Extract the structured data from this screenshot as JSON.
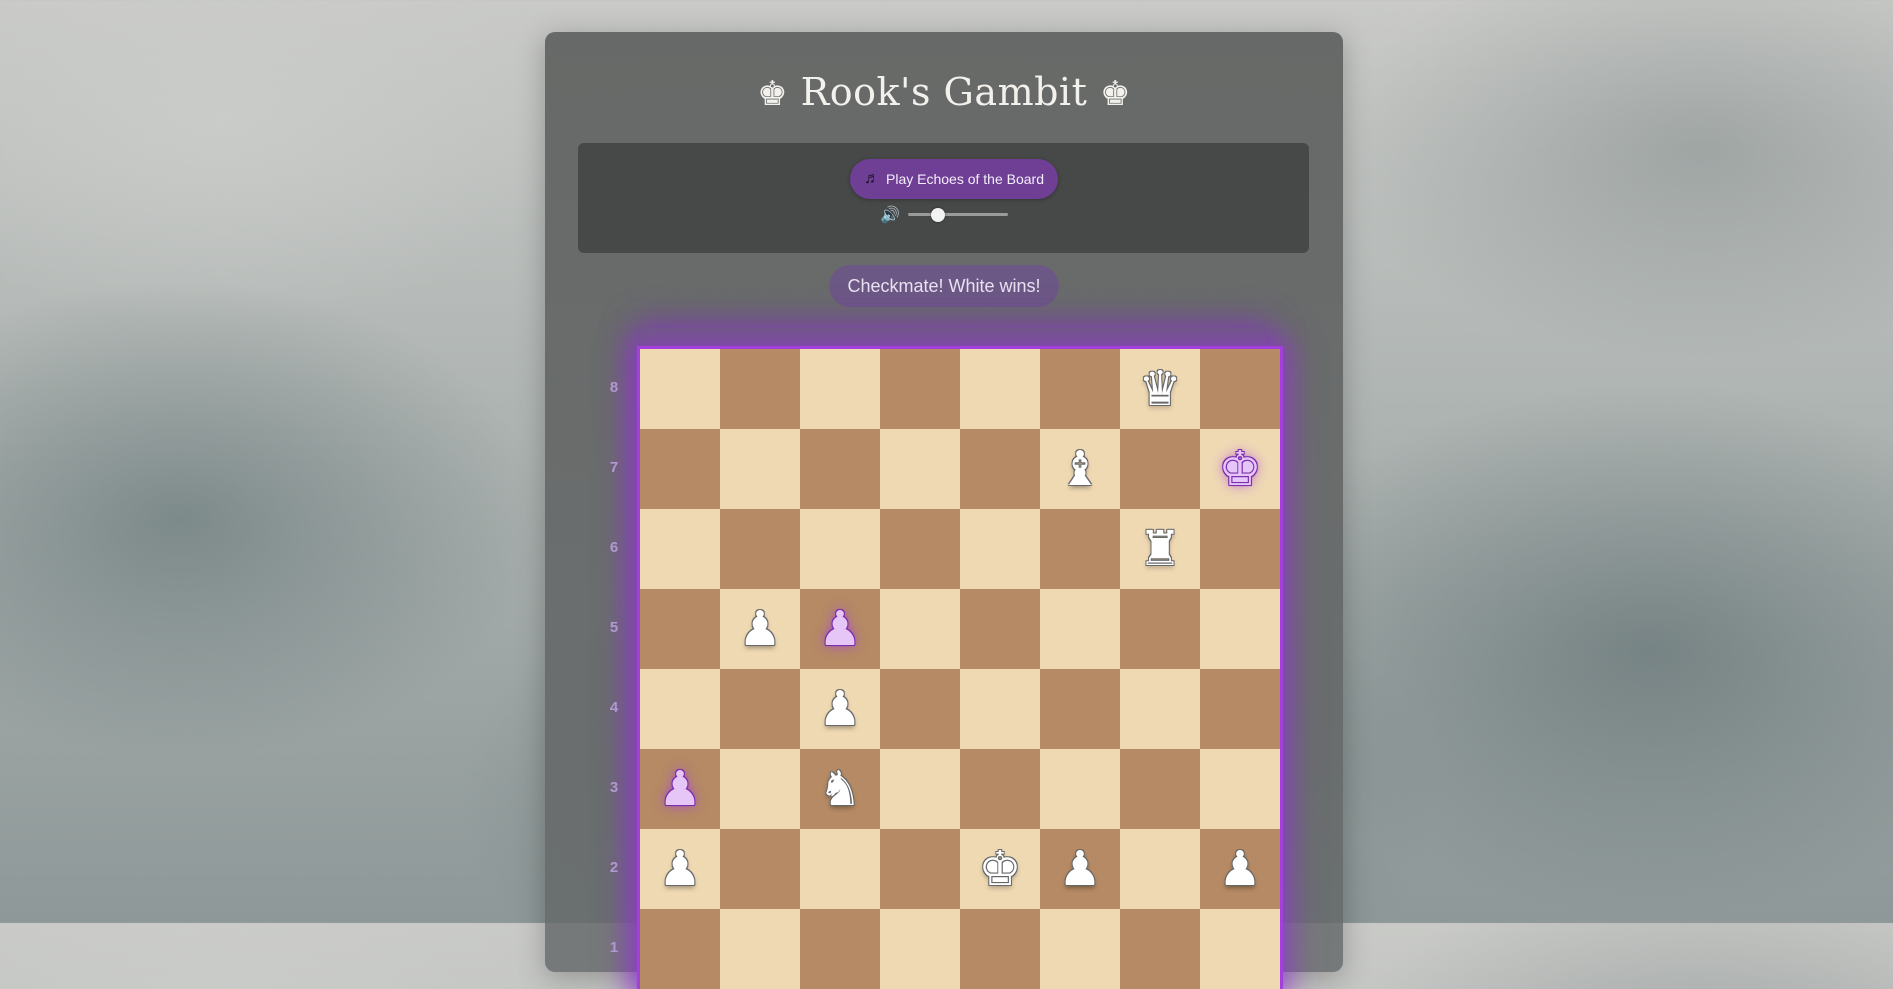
{
  "title": {
    "left_icon": "crown-icon",
    "left_glyph": "♚",
    "text": "Rook's Gambit",
    "right_glyph": "♚",
    "right_icon": "crown-icon"
  },
  "audio": {
    "button_glyph": "♬",
    "button_label": "Play Echoes of the Board",
    "speaker_glyph": "🔊",
    "volume": 0.3
  },
  "status": "Checkmate! White wins!",
  "colors": {
    "accent": "#6f3f96",
    "board_light": "#efd9b3",
    "board_dark": "#b58a64",
    "glow": "#a340dd"
  },
  "board": {
    "rank_labels": [
      "8",
      "7",
      "6",
      "5",
      "4",
      "3",
      "2",
      "1"
    ],
    "ranks": [
      [
        "",
        "",
        "",
        "",
        "",
        "",
        "wQ",
        ""
      ],
      [
        "",
        "",
        "",
        "",
        "",
        "wB",
        "",
        "bK"
      ],
      [
        "",
        "",
        "",
        "",
        "",
        "",
        "wR",
        ""
      ],
      [
        "",
        "wP",
        "bP",
        "",
        "",
        "",
        "",
        ""
      ],
      [
        "",
        "",
        "wP",
        "",
        "",
        "",
        "",
        ""
      ],
      [
        "bP",
        "",
        "wN",
        "",
        "",
        "",
        "",
        ""
      ],
      [
        "wP",
        "",
        "",
        "",
        "wK",
        "wP",
        "",
        "wP"
      ],
      [
        "",
        "",
        "",
        "",
        "",
        "",
        "",
        ""
      ]
    ]
  }
}
